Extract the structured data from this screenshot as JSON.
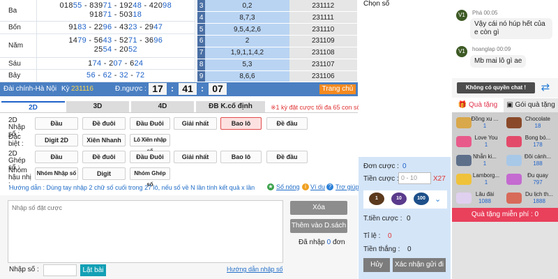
{
  "results": [
    {
      "name": "Ba",
      "lines": [
        [
          [
            "018",
            "55"
          ],
          [
            "839",
            "71"
          ],
          [
            "192",
            "48"
          ],
          [
            "420",
            "98"
          ]
        ],
        [
          [
            "918",
            "71"
          ],
          [
            "503",
            "18"
          ]
        ]
      ]
    },
    {
      "name": "Bốn",
      "lines": [
        [
          [
            "91",
            "83"
          ],
          [
            "22",
            "96"
          ],
          [
            "43",
            "23"
          ],
          [
            "29",
            "47"
          ]
        ]
      ]
    },
    {
      "name": "Năm",
      "lines": [
        [
          [
            "14",
            "79"
          ],
          [
            "56",
            "43"
          ],
          [
            "52",
            "71"
          ],
          [
            "36",
            "96"
          ]
        ],
        [
          [
            "25",
            "54"
          ],
          [
            "20",
            "52"
          ]
        ]
      ]
    },
    {
      "name": "Sáu",
      "lines": [
        [
          [
            "1",
            "74"
          ],
          [
            "2",
            "07"
          ],
          [
            "6",
            "24"
          ]
        ]
      ]
    },
    {
      "name": "Bảy",
      "lines": [
        [
          [
            "",
            "56"
          ],
          [
            "",
            "62"
          ],
          [
            "",
            "32"
          ],
          [
            "",
            "72"
          ]
        ]
      ]
    }
  ],
  "history": [
    {
      "idx": "3",
      "nums": "0,2",
      "date": "231112"
    },
    {
      "idx": "4",
      "nums": "8,7,3",
      "date": "231111"
    },
    {
      "idx": "5",
      "nums": "9,5,4,2,6",
      "date": "231110"
    },
    {
      "idx": "6",
      "nums": "2",
      "date": "231109"
    },
    {
      "idx": "7",
      "nums": "1,9,1,1,4,2",
      "date": "231108"
    },
    {
      "idx": "8",
      "nums": "5,3",
      "date": "231107"
    },
    {
      "idx": "9",
      "nums": "8,6,6",
      "date": "231106"
    }
  ],
  "bar": {
    "station": "Đài chính-Hà Nội",
    "ky_label": "Kỳ",
    "ky_value": "231116",
    "countdown_label": "Đ.ngược :",
    "hh": "17",
    "mm": "41",
    "ss": "07",
    "home": "Trang chủ"
  },
  "tabs": [
    "2D",
    "3D",
    "4D",
    "ĐB K.cố định"
  ],
  "notice": "※1 kỳ đặt cược tối đa 65 con số",
  "rows": {
    "r1": {
      "label": "2D Nhập số :",
      "buttons": [
        "Đầu",
        "Đề đuôi",
        "Đầu Đuôi",
        "Giải nhất",
        "Bao lô",
        "Đề đầu"
      ]
    },
    "r2": {
      "label": "Đặc biệt :",
      "buttons": [
        "Digit 2D",
        "Xiên Nhanh",
        "Lô Xiên nhập số"
      ]
    },
    "r3": {
      "label": "2D Ghép số :",
      "buttons": [
        "Đầu",
        "Đề đuôi",
        "Đầu Đuôi",
        "Giải nhất",
        "Bao lô",
        "Đề đầu"
      ]
    },
    "r4": {
      "label": "Nhóm hậu nhị :",
      "buttons": [
        "Nhóm Nhập số",
        "Digit",
        "Nhóm Ghép số"
      ]
    }
  },
  "hint": "Hướng dẫn : Dùng tay nhập 2 chữ số cuối trong 27 lô, nếu số về N lần tính kết quả x lần",
  "links": [
    "Số nóng",
    "Ví dụ",
    "Trợ giúp"
  ],
  "textarea_placeholder": "Nhập số đặt cược",
  "clear": "Xóa",
  "add_slip": "Thêm vào D.sách",
  "entered": {
    "label": "Đã nhập",
    "count": "0",
    "unit": "đơn"
  },
  "input_label": "Nhập số :",
  "flip": "Lật bài",
  "guide": "Hướng dẫn nhập số",
  "bet": {
    "choose": "Chọn số",
    "don_cuoc_label": "Đơn cược :",
    "don_cuoc": "0",
    "tien_cuoc_label": "Tiền cược :",
    "amount_placeholder": "0 - 10",
    "multiplier": "X27",
    "chips": [
      "1",
      "10",
      "100"
    ],
    "total_label": "T.tiền cược :",
    "total": "0",
    "rate_label": "Tỉ lệ :",
    "rate": "0",
    "win_label": "Tiền thắng :",
    "win": "0",
    "cancel": "Hủy",
    "confirm": "Xác nhận gửi đi"
  },
  "chat": [
    {
      "avatar": "V1",
      "name": "Phá",
      "time": "00:05",
      "msg": "Vậy cái nó húp hết của e còn gì"
    },
    {
      "avatar": "V1",
      "name": "hoanglap",
      "time": "00:09",
      "msg": "Mb mai lô gì ae"
    }
  ],
  "no_chat": "Không có quyền chat !",
  "gift_tabs": [
    "Quà tặng",
    "Gói quà tặng"
  ],
  "gifts": [
    {
      "name": "Đồng xu ...",
      "value": "1"
    },
    {
      "name": "Chocolate",
      "value": "18"
    },
    {
      "name": "Love You",
      "value": "1"
    },
    {
      "name": "Bong bó...",
      "value": "178"
    },
    {
      "name": "Nhẫn ki...",
      "value": "1"
    },
    {
      "name": "Đôi cánh...",
      "value": "188"
    },
    {
      "name": "Lamborg...",
      "value": "1"
    },
    {
      "name": "Đu quay",
      "value": "797"
    },
    {
      "name": "Lâu đài",
      "value": "1088"
    },
    {
      "name": "Du lịch th...",
      "value": "1888"
    }
  ],
  "free_gift": "Quà tặng miễn phí : 0",
  "colors": {
    "primary": "#4a7fc2",
    "accent": "#e9405b",
    "orange": "#f58a1f",
    "teal": "#13a0b5"
  }
}
